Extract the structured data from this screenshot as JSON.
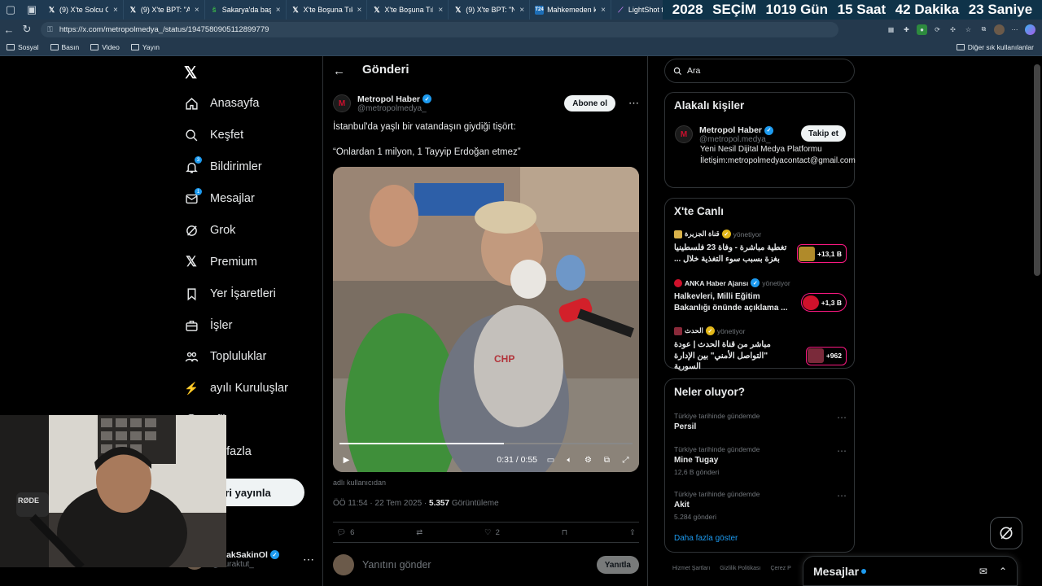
{
  "browser": {
    "tabs": [
      {
        "title": "(9) X'te Solcu G",
        "icon": "x-logo"
      },
      {
        "title": "(9) X'te BPT: \"Ar",
        "icon": "x-logo"
      },
      {
        "title": "Sakarya'da başl",
        "icon": "news-icon"
      },
      {
        "title": "X'te Boşuna Tıkl",
        "icon": "x-logo"
      },
      {
        "title": "X'te Boşuna Tıkl",
        "icon": "x-logo"
      },
      {
        "title": "(9) X'te BPT: \"N",
        "icon": "x-logo"
      },
      {
        "title": "Mahkemeden k",
        "icon": "t24-icon"
      },
      {
        "title": "LightShot tarafı",
        "icon": "lightshot-icon"
      }
    ],
    "countdown": {
      "year": "2028",
      "label": "SEÇİM",
      "days": "1019 Gün",
      "hours": "15 Saat",
      "minutes": "42 Dakika",
      "seconds": "23 Saniye"
    },
    "url": "https://x.com/metropolmedya_/status/1947580905112899779",
    "bookmarks": [
      "Sosyal",
      "Basın",
      "Video",
      "Yayın"
    ],
    "other_bookmarks": "Diğer sık kullanılanlar"
  },
  "nav": {
    "items": [
      {
        "label": "Anasayfa",
        "icon": "home-icon"
      },
      {
        "label": "Keşfet",
        "icon": "search-icon"
      },
      {
        "label": "Bildirimler",
        "icon": "bell-icon",
        "badge": "3"
      },
      {
        "label": "Mesajlar",
        "icon": "mail-icon",
        "badge": "1"
      },
      {
        "label": "Grok",
        "icon": "grok-icon"
      },
      {
        "label": "Premium",
        "icon": "x-logo"
      },
      {
        "label": "Yer İşaretleri",
        "icon": "bookmark-icon"
      },
      {
        "label": "İşler",
        "icon": "briefcase-icon"
      },
      {
        "label": "Topluluklar",
        "icon": "people-icon"
      },
      {
        "label": "ayılı Kuruluşlar",
        "icon": "lightning-icon"
      },
      {
        "label": "ofil",
        "icon": "person-icon"
      },
      {
        "label": "ha fazla",
        "icon": "more-icon"
      }
    ],
    "post_button": "nderi yayınla",
    "account": {
      "name": "BurakSakinOl",
      "handle": "@buraktut_"
    }
  },
  "post": {
    "header_title": "Gönderi",
    "author": {
      "name": "Metropol Haber",
      "handle": "@metropolmedya_",
      "logo_letter": "M"
    },
    "subscribe_label": "Abone ol",
    "text_line1": "İstanbul'da yaşlı bir vatandaşın giydiği tişört:",
    "text_line2": "“Onlardan 1 milyon, 1 Tayyip Erdoğan etmez”",
    "video": {
      "time": "0:31 / 0:55",
      "progress_fraction": 0.56
    },
    "credit": "adlı kullanıcıdan",
    "timestamp": "ÖÖ 11:54 · 22 Tem 2025 ·",
    "views": "5.357",
    "views_label": "Görüntüleme",
    "replies": "6",
    "likes": "2",
    "reply_placeholder": "Yanıtını gönder",
    "reply_button": "Yanıtla"
  },
  "right": {
    "search_placeholder": "Ara",
    "relevant": {
      "title": "Alakalı kişiler",
      "name": "Metropol Haber",
      "handle": "@metropol.medya_",
      "follow": "Takip et",
      "bio": "Yeni Nesil Dijital Medya Platformu İletişim:metropolmedyacontact@gmail.com"
    },
    "live": {
      "title": "X'te Canlı",
      "items": [
        {
          "source": "قناة الجزيرة",
          "role": "yönetiyor",
          "text": "تغطية مباشرة - وفاة 23 فلسطينيا\nبغزة بسبب سوء التغذية خلال ...",
          "count": "+13,1 B",
          "accent": "#b08a2a"
        },
        {
          "source": "ANKA Haber Ajansı",
          "role": "yönetiyor",
          "text": "Halkevleri, Milli Eğitim\nBakanlığı önünde açıklama ...",
          "count": "+1,3 B",
          "accent": "#d0112b"
        },
        {
          "source": "الحدث",
          "role": "yönetiyor",
          "text": "مباشر من قناة الحدث | عودة\n\"التواصل الأمني\" بين الإدارة السورية",
          "count": "+962",
          "accent": "#7a2a3a"
        }
      ]
    },
    "trends": {
      "title": "Neler oluyor?",
      "items": [
        {
          "category": "Türkiye tarihinde gündemde",
          "name": "Persil",
          "count": ""
        },
        {
          "category": "Türkiye tarihinde gündemde",
          "name": "Mine Tugay",
          "count": "12,6 B gönderi"
        },
        {
          "category": "Türkiye tarihinde gündemde",
          "name": "Akit",
          "count": "5.284 gönderi"
        }
      ],
      "show_more": "Daha fazla göster"
    },
    "footer": [
      "Hizmet Şartları",
      "Gizlilik Politikası",
      "Çerez P"
    ]
  },
  "messages_dock": {
    "title": "Mesajlar"
  },
  "colors": {
    "accent": "#1d9bf0",
    "live_border": "#f91880",
    "background": "#000000"
  }
}
